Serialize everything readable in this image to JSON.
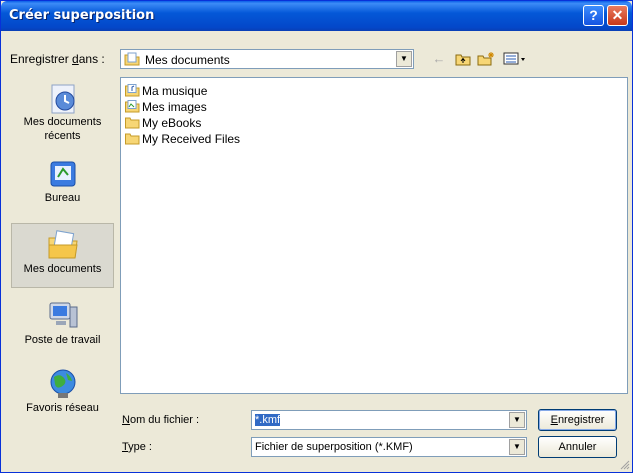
{
  "window": {
    "title": "Créer superposition"
  },
  "titlebar_buttons": {
    "help": "?",
    "close": "✕"
  },
  "lookin": {
    "label": "Enregistrer dans :",
    "label_pre": "Enregistrer ",
    "label_accel": "d",
    "label_post": "ans :",
    "value": "Mes documents"
  },
  "toolbar": {
    "back_icon": "arrow-left-icon",
    "up_icon": "folder-up-icon",
    "newfolder_icon": "new-folder-icon",
    "views_icon": "views-menu-icon"
  },
  "places": [
    {
      "label1": "Mes documents",
      "label2": "récents"
    },
    {
      "label1": "Bureau",
      "label2": ""
    },
    {
      "label1": "Mes documents",
      "label2": ""
    },
    {
      "label1": "Poste de travail",
      "label2": ""
    },
    {
      "label1": "Favoris réseau",
      "label2": ""
    }
  ],
  "files": [
    {
      "name": "Ma musique"
    },
    {
      "name": "Mes images"
    },
    {
      "name": "My eBooks"
    },
    {
      "name": "My Received Files"
    }
  ],
  "filename": {
    "label_accel": "N",
    "label_rest": "om du fichier :",
    "value": "*.kmf"
  },
  "filetype": {
    "label_accel": "T",
    "label_rest": "ype :",
    "value": "Fichier de superposition (*.KMF)"
  },
  "buttons": {
    "save_accel": "E",
    "save_rest": "nregistrer",
    "cancel": "Annuler"
  },
  "colors": {
    "titlebar": "#0458d8",
    "dialog_bg": "#ece9d8",
    "selection": "#316ac5"
  }
}
